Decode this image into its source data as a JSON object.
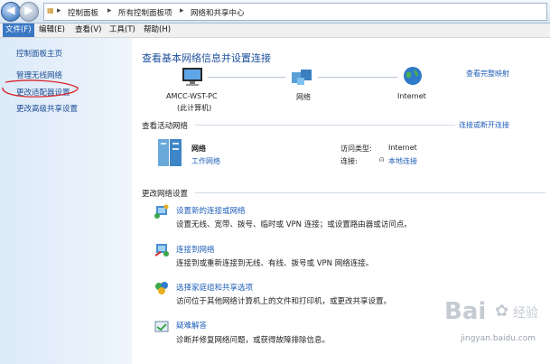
{
  "breadcrumbs": [
    "控制面板",
    "所有控制面板项",
    "网络和共享中心"
  ],
  "menu": [
    "文件(F)",
    "编辑(E)",
    "查看(V)",
    "工具(T)",
    "帮助(H)"
  ],
  "sidebar": {
    "items": [
      {
        "label": "控制面板主页"
      },
      {
        "label": "管理无线网络"
      },
      {
        "label": "更改适配器设置"
      },
      {
        "label": "更改高级共享设置"
      }
    ]
  },
  "main": {
    "title": "查看基本网络信息并设置连接",
    "full_map_link": "查看完整映射",
    "map": {
      "computer_name": "AMCC-WST-PC",
      "computer_sub": "(此计算机)",
      "network": "网络",
      "internet": "Internet"
    },
    "active_section": {
      "title": "查看活动网络",
      "connect_link": "连接或断开连接",
      "network_name": "网络",
      "network_type": "工作网络",
      "access_type_label": "访问类型:",
      "access_type_value": "Internet",
      "connection_label": "连接:",
      "connection_value": "本地连接"
    },
    "settings_section": {
      "title": "更改网络设置",
      "tasks": [
        {
          "title": "设置新的连接或网络",
          "desc": "设置无线、宽带、拨号、临时或 VPN 连接；或设置路由器或访问点。"
        },
        {
          "title": "连接到网络",
          "desc": "连接到或重新连接到无线、有线、拨号或 VPN 网络连接。"
        },
        {
          "title": "选择家庭组和共享选项",
          "desc": "访问位于其他网络计算机上的文件和打印机，或更改共享设置。"
        },
        {
          "title": "疑难解答",
          "desc": "诊断并修复网络问题，或获得故障排除信息。"
        }
      ]
    }
  },
  "watermark": {
    "brand": "Bai",
    "brand2": "经验",
    "url": "jingyan.baidu.com"
  },
  "colors": {
    "link": "#1f5fb8",
    "title": "#1d4f9c",
    "menu_active": "#3b78c4",
    "annotation": "#d9262b"
  }
}
